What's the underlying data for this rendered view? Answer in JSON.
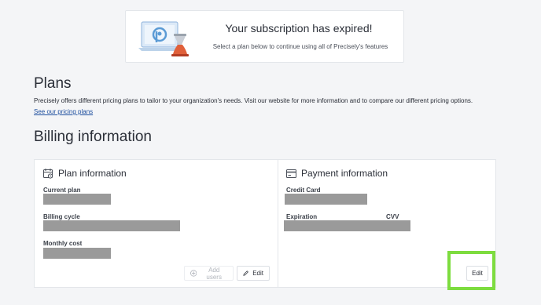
{
  "banner": {
    "title": "Your subscription has expired!",
    "subtitle": "Select a plan below to continue using all of Precisely's features",
    "illustration_icon": "laptop-hourglass-icon"
  },
  "plans": {
    "title": "Plans",
    "description": "Precisely offers different pricing plans to tailor to your organization's needs. Visit our website for more information and to compare our different pricing options.",
    "pricing_link": "See our pricing plans"
  },
  "billing": {
    "title": "Billing information",
    "plan_info": {
      "title": "Plan information",
      "icon": "calendar-icon",
      "current_plan_label": "Current plan",
      "billing_cycle_label": "Billing cycle",
      "monthly_cost_label": "Monthly cost",
      "add_users_label": "Add users",
      "edit_label": "Edit"
    },
    "payment_info": {
      "title": "Payment information",
      "icon": "credit-card-icon",
      "credit_card_label": "Credit Card",
      "expiration_label": "Expiration",
      "cvv_label": "CVV",
      "edit_label": "Edit"
    }
  },
  "colors": {
    "highlight": "#7ddc3f",
    "link": "#1d4e9e",
    "redacted": "#9a9a9a",
    "background": "#f4f5f7"
  }
}
